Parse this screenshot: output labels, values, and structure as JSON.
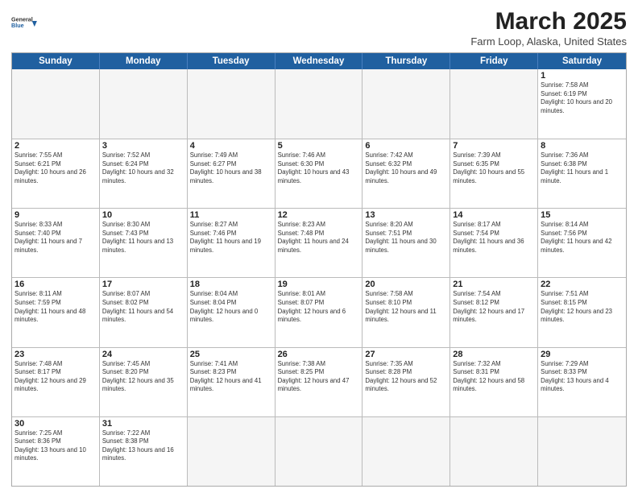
{
  "header": {
    "logo_line1": "General",
    "logo_line2": "Blue",
    "title": "March 2025",
    "subtitle": "Farm Loop, Alaska, United States"
  },
  "weekdays": [
    "Sunday",
    "Monday",
    "Tuesday",
    "Wednesday",
    "Thursday",
    "Friday",
    "Saturday"
  ],
  "weeks": [
    [
      {
        "day": "",
        "info": ""
      },
      {
        "day": "",
        "info": ""
      },
      {
        "day": "",
        "info": ""
      },
      {
        "day": "",
        "info": ""
      },
      {
        "day": "",
        "info": ""
      },
      {
        "day": "",
        "info": ""
      },
      {
        "day": "1",
        "info": "Sunrise: 7:58 AM\nSunset: 6:19 PM\nDaylight: 10 hours and 20 minutes."
      }
    ],
    [
      {
        "day": "2",
        "info": "Sunrise: 7:55 AM\nSunset: 6:21 PM\nDaylight: 10 hours and 26 minutes."
      },
      {
        "day": "3",
        "info": "Sunrise: 7:52 AM\nSunset: 6:24 PM\nDaylight: 10 hours and 32 minutes."
      },
      {
        "day": "4",
        "info": "Sunrise: 7:49 AM\nSunset: 6:27 PM\nDaylight: 10 hours and 38 minutes."
      },
      {
        "day": "5",
        "info": "Sunrise: 7:46 AM\nSunset: 6:30 PM\nDaylight: 10 hours and 43 minutes."
      },
      {
        "day": "6",
        "info": "Sunrise: 7:42 AM\nSunset: 6:32 PM\nDaylight: 10 hours and 49 minutes."
      },
      {
        "day": "7",
        "info": "Sunrise: 7:39 AM\nSunset: 6:35 PM\nDaylight: 10 hours and 55 minutes."
      },
      {
        "day": "8",
        "info": "Sunrise: 7:36 AM\nSunset: 6:38 PM\nDaylight: 11 hours and 1 minute."
      }
    ],
    [
      {
        "day": "9",
        "info": "Sunrise: 8:33 AM\nSunset: 7:40 PM\nDaylight: 11 hours and 7 minutes."
      },
      {
        "day": "10",
        "info": "Sunrise: 8:30 AM\nSunset: 7:43 PM\nDaylight: 11 hours and 13 minutes."
      },
      {
        "day": "11",
        "info": "Sunrise: 8:27 AM\nSunset: 7:46 PM\nDaylight: 11 hours and 19 minutes."
      },
      {
        "day": "12",
        "info": "Sunrise: 8:23 AM\nSunset: 7:48 PM\nDaylight: 11 hours and 24 minutes."
      },
      {
        "day": "13",
        "info": "Sunrise: 8:20 AM\nSunset: 7:51 PM\nDaylight: 11 hours and 30 minutes."
      },
      {
        "day": "14",
        "info": "Sunrise: 8:17 AM\nSunset: 7:54 PM\nDaylight: 11 hours and 36 minutes."
      },
      {
        "day": "15",
        "info": "Sunrise: 8:14 AM\nSunset: 7:56 PM\nDaylight: 11 hours and 42 minutes."
      }
    ],
    [
      {
        "day": "16",
        "info": "Sunrise: 8:11 AM\nSunset: 7:59 PM\nDaylight: 11 hours and 48 minutes."
      },
      {
        "day": "17",
        "info": "Sunrise: 8:07 AM\nSunset: 8:02 PM\nDaylight: 11 hours and 54 minutes."
      },
      {
        "day": "18",
        "info": "Sunrise: 8:04 AM\nSunset: 8:04 PM\nDaylight: 12 hours and 0 minutes."
      },
      {
        "day": "19",
        "info": "Sunrise: 8:01 AM\nSunset: 8:07 PM\nDaylight: 12 hours and 6 minutes."
      },
      {
        "day": "20",
        "info": "Sunrise: 7:58 AM\nSunset: 8:10 PM\nDaylight: 12 hours and 11 minutes."
      },
      {
        "day": "21",
        "info": "Sunrise: 7:54 AM\nSunset: 8:12 PM\nDaylight: 12 hours and 17 minutes."
      },
      {
        "day": "22",
        "info": "Sunrise: 7:51 AM\nSunset: 8:15 PM\nDaylight: 12 hours and 23 minutes."
      }
    ],
    [
      {
        "day": "23",
        "info": "Sunrise: 7:48 AM\nSunset: 8:17 PM\nDaylight: 12 hours and 29 minutes."
      },
      {
        "day": "24",
        "info": "Sunrise: 7:45 AM\nSunset: 8:20 PM\nDaylight: 12 hours and 35 minutes."
      },
      {
        "day": "25",
        "info": "Sunrise: 7:41 AM\nSunset: 8:23 PM\nDaylight: 12 hours and 41 minutes."
      },
      {
        "day": "26",
        "info": "Sunrise: 7:38 AM\nSunset: 8:25 PM\nDaylight: 12 hours and 47 minutes."
      },
      {
        "day": "27",
        "info": "Sunrise: 7:35 AM\nSunset: 8:28 PM\nDaylight: 12 hours and 52 minutes."
      },
      {
        "day": "28",
        "info": "Sunrise: 7:32 AM\nSunset: 8:31 PM\nDaylight: 12 hours and 58 minutes."
      },
      {
        "day": "29",
        "info": "Sunrise: 7:29 AM\nSunset: 8:33 PM\nDaylight: 13 hours and 4 minutes."
      }
    ],
    [
      {
        "day": "30",
        "info": "Sunrise: 7:25 AM\nSunset: 8:36 PM\nDaylight: 13 hours and 10 minutes."
      },
      {
        "day": "31",
        "info": "Sunrise: 7:22 AM\nSunset: 8:38 PM\nDaylight: 13 hours and 16 minutes."
      },
      {
        "day": "",
        "info": ""
      },
      {
        "day": "",
        "info": ""
      },
      {
        "day": "",
        "info": ""
      },
      {
        "day": "",
        "info": ""
      },
      {
        "day": "",
        "info": ""
      }
    ]
  ]
}
